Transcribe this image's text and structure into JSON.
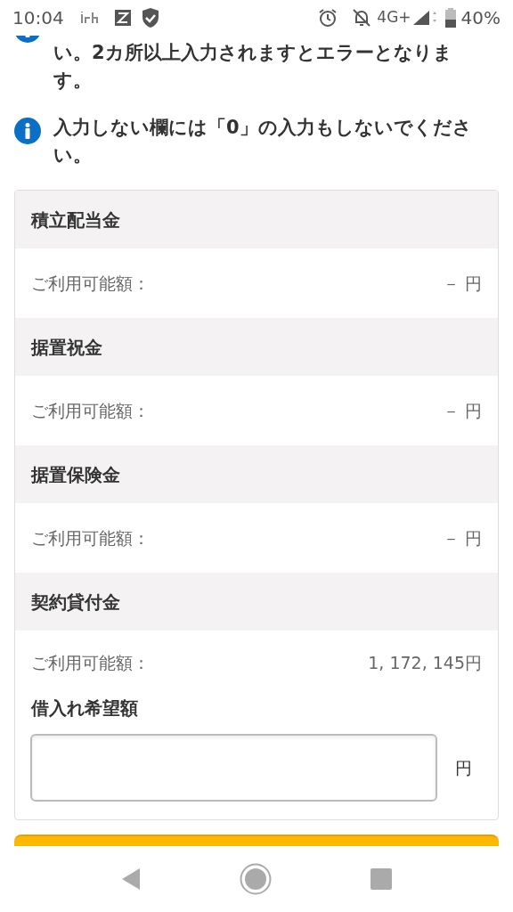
{
  "status_bar": {
    "time": "10:04",
    "network": "4G+",
    "battery": "40%"
  },
  "notes": [
    {
      "text": "い。2カ所以上入力されますとエラーとなります。"
    },
    {
      "text": "入力しない欄には「0」の入力もしないでください。"
    }
  ],
  "sections": [
    {
      "title": "積立配当金",
      "label": "ご利用可能額：",
      "amount": "－ 円"
    },
    {
      "title": "据置祝金",
      "label": "ご利用可能額：",
      "amount": "－ 円"
    },
    {
      "title": "据置保険金",
      "label": "ご利用可能額：",
      "amount": "－ 円"
    },
    {
      "title": "契約貸付金",
      "label": "ご利用可能額：",
      "amount": "1, 172, 145円",
      "input": {
        "label": "借入れ希望額",
        "unit": "円"
      }
    }
  ]
}
